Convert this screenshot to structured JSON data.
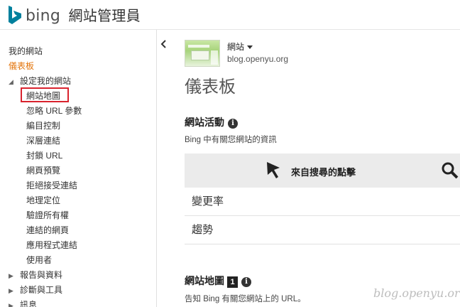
{
  "header": {
    "brand": "bing",
    "subtitle": "網站管理員",
    "accent": "#00809d"
  },
  "sidebar": {
    "items": [
      {
        "label": "我的網站",
        "active": false
      },
      {
        "label": "儀表板",
        "active": true
      },
      {
        "label": "設定我的網站",
        "expanded": true
      },
      {
        "label": "網站地圖",
        "highlighted": true
      },
      {
        "label": "忽略 URL 參數"
      },
      {
        "label": "編目控制"
      },
      {
        "label": "深層連結"
      },
      {
        "label": "封鎖 URL"
      },
      {
        "label": "網頁預覽"
      },
      {
        "label": "拒絕接受連結"
      },
      {
        "label": "地理定位"
      },
      {
        "label": "驗證所有權"
      },
      {
        "label": "連結的網頁"
      },
      {
        "label": "應用程式連結"
      },
      {
        "label": "使用者"
      },
      {
        "label": "報告與資料",
        "expanded": false
      },
      {
        "label": "診斷與工具",
        "expanded": false
      },
      {
        "label": "訊息",
        "expanded": false
      }
    ],
    "active_color": "#e3740a",
    "highlight_border": "#d9232e",
    "collapse_icon": "chevron-left-icon"
  },
  "site": {
    "name": "網站",
    "url": "blog.openyu.org"
  },
  "main": {
    "page_title": "儀表板",
    "activity": {
      "title": "網站活動",
      "description": "Bing 中有關您網站的資訊",
      "clicks_label": "來自搜尋的點擊",
      "rows": [
        "變更率",
        "趨勢"
      ]
    },
    "sitemap": {
      "title": "網站地圖",
      "badge": "1",
      "description": "告知 Bing 有關您網站上的 URL。"
    }
  },
  "watermark": "blog.openyu.org"
}
